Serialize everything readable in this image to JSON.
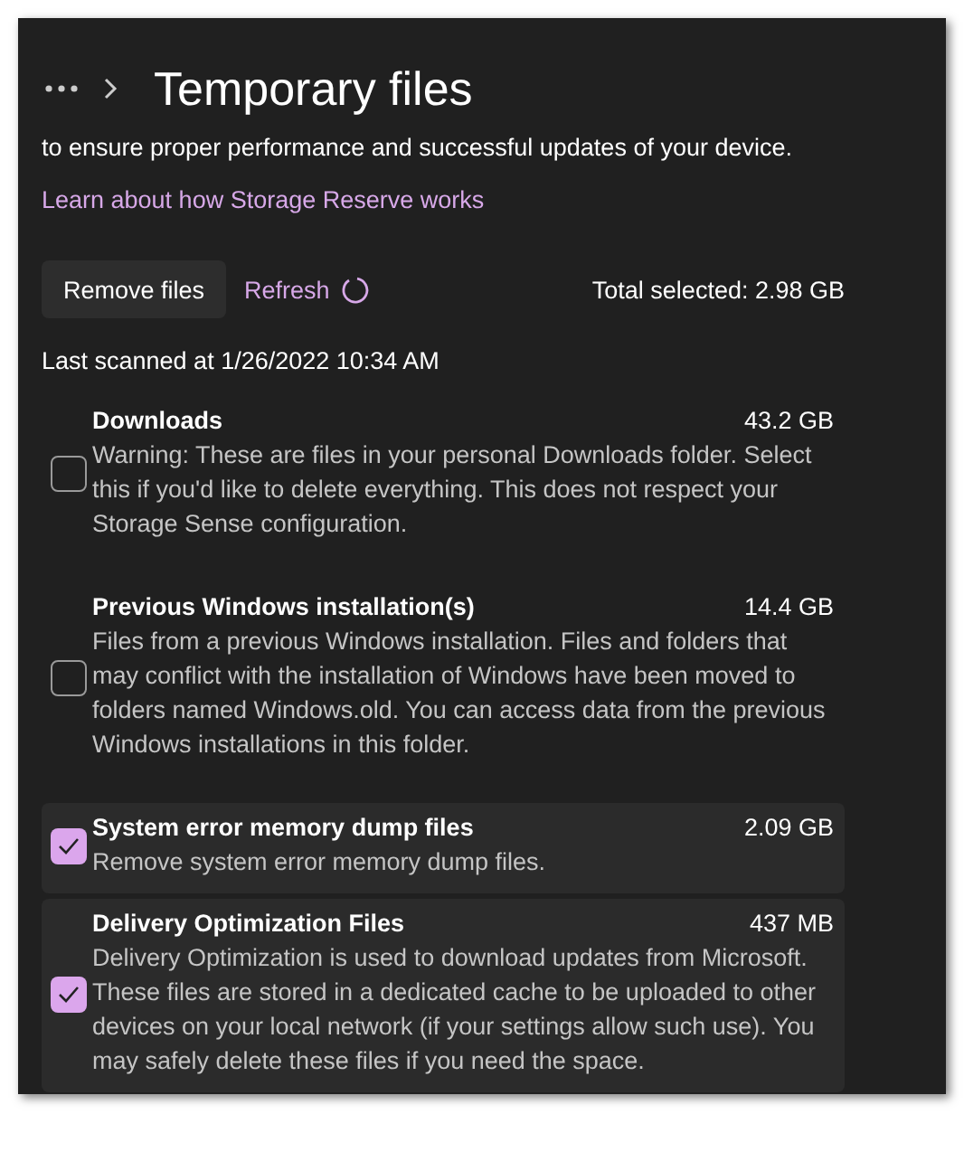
{
  "breadcrumb": {
    "title": "Temporary files"
  },
  "intro": "to ensure proper performance and successful updates of your device.",
  "link": "Learn about how Storage Reserve works",
  "actions": {
    "remove": "Remove files",
    "refresh": "Refresh",
    "total": "Total selected: 2.98 GB"
  },
  "last_scanned": "Last scanned at 1/26/2022 10:34 AM",
  "items": [
    {
      "name": "Downloads",
      "size": "43.2 GB",
      "description": "Warning: These are files in your personal Downloads folder. Select this if you'd like to delete everything. This does not respect your Storage Sense configuration.",
      "checked": false
    },
    {
      "name": "Previous Windows installation(s)",
      "size": "14.4 GB",
      "description": "Files from a previous Windows installation.  Files and folders that may conflict with the installation of Windows have been moved to folders named Windows.old.  You can access data from the previous Windows installations in this folder.",
      "checked": false
    },
    {
      "name": "System error memory dump files",
      "size": "2.09 GB",
      "description": "Remove system error memory dump files.",
      "checked": true
    },
    {
      "name": "Delivery Optimization Files",
      "size": "437 MB",
      "description": "Delivery Optimization is used to download updates from Microsoft. These files are stored in a dedicated cache to be uploaded to other devices on your local network (if your settings allow such use). You may safely delete these files if you need the space.",
      "checked": true
    }
  ]
}
